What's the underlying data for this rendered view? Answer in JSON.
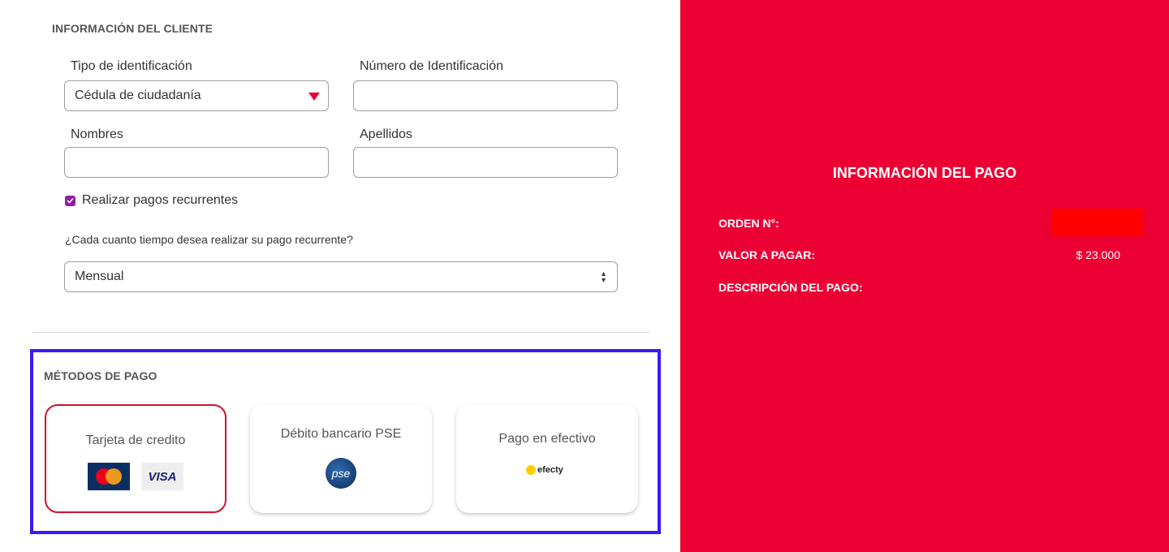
{
  "client": {
    "section_title": "INFORMACIÓN DEL CLIENTE",
    "id_type_label": "Tipo de identificación",
    "id_type_value": "Cédula de ciudadanía",
    "id_number_label": "Número de Identificación",
    "id_number_value": "",
    "names_label": "Nombres",
    "names_value": "",
    "surnames_label": "Apellidos",
    "surnames_value": "",
    "recurrent_checkbox_label": "Realizar pagos recurrentes",
    "recurrent_checked": true,
    "frequency_question": "¿Cada cuanto tiempo desea realizar su pago recurrente?",
    "frequency_value": "Mensual"
  },
  "methods": {
    "section_title": "MÉTODOS DE PAGO",
    "card_label": "Tarjeta de credito",
    "card_logos": [
      "MasterCard",
      "VISA"
    ],
    "pse_label": "Débito bancario PSE",
    "pse_logo": "pse",
    "cash_label": "Pago en efectivo",
    "cash_logo": "efecty",
    "selected": "Tarjeta de credito"
  },
  "payment": {
    "title": "INFORMACIÓN DEL PAGO",
    "order_label": "ORDEN N°:",
    "amount_label": "VALOR A PAGAR:",
    "amount_value": "$ 23.000",
    "description_label": "DESCRIPCIÓN DEL PAGO:"
  },
  "colors": {
    "panel_red": "#ec0034",
    "highlight_box": "#3b19f5",
    "checkbox_purple": "#8e1ea0",
    "selected_card_border": "#d4102f"
  },
  "icons": {
    "select_caret": "triangle-down-icon",
    "select_updown": "updown-arrows-icon",
    "checkbox": "check-icon"
  }
}
